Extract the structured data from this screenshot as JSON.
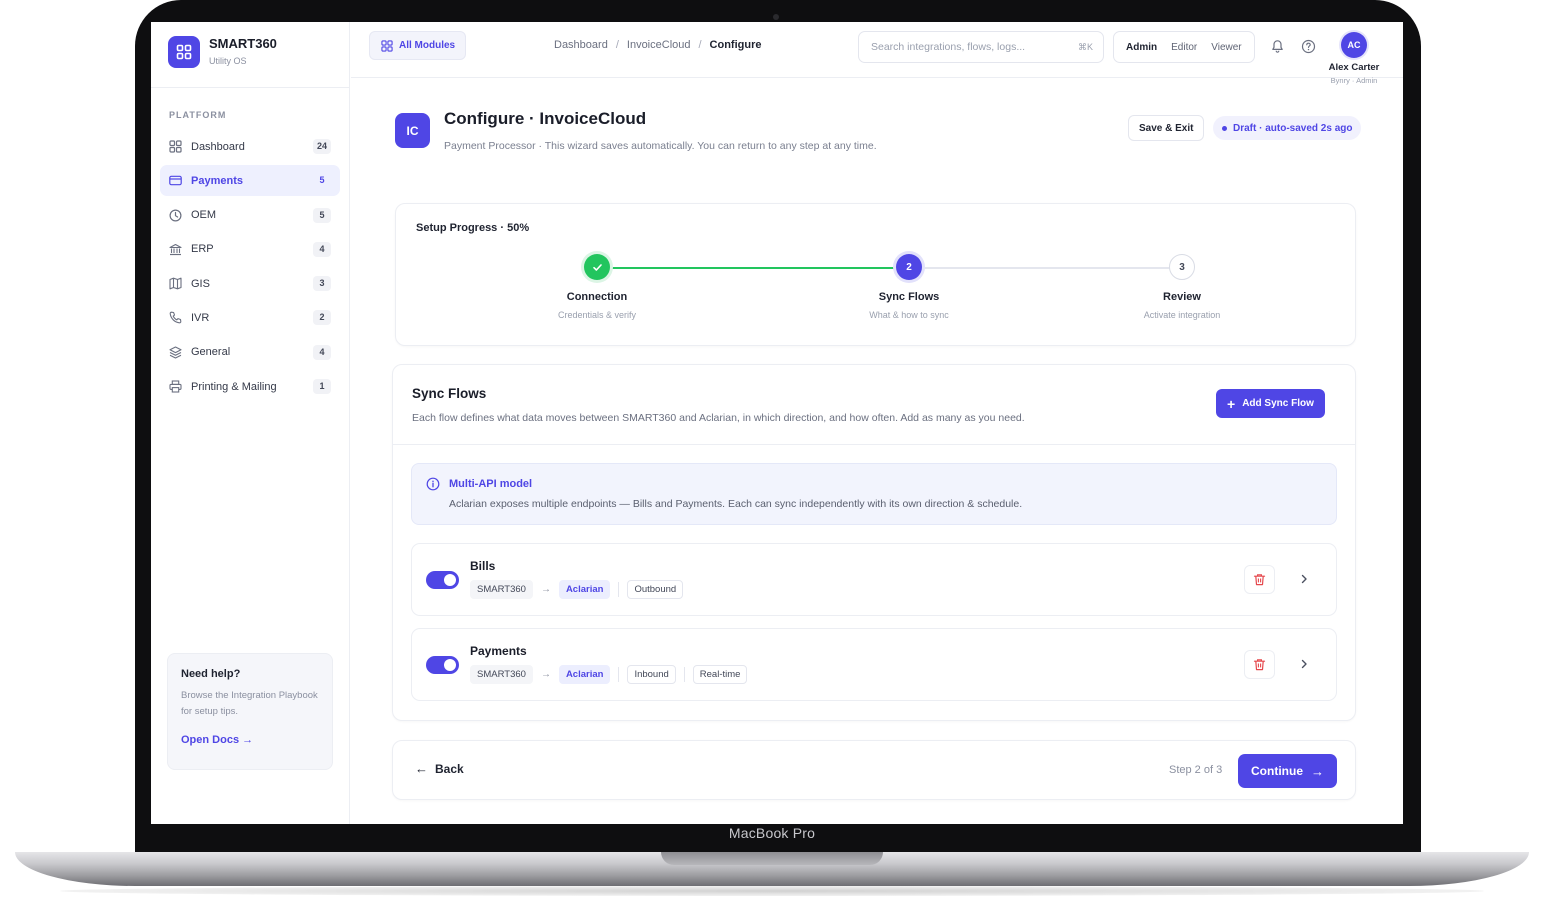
{
  "device": {
    "brand_label": "MacBook Pro"
  },
  "app": {
    "name": "SMART360",
    "subtitle": "Utility OS"
  },
  "sidebar": {
    "section_label": "PLATFORM",
    "items": [
      {
        "label": "Dashboard",
        "count": "24",
        "icon": "grid-icon",
        "active": false
      },
      {
        "label": "Payments",
        "count": "5",
        "icon": "credit-card-icon",
        "active": true
      },
      {
        "label": "OEM",
        "count": "5",
        "icon": "clock-icon",
        "active": false
      },
      {
        "label": "ERP",
        "count": "4",
        "icon": "bank-icon",
        "active": false
      },
      {
        "label": "GIS",
        "count": "3",
        "icon": "map-icon",
        "active": false
      },
      {
        "label": "IVR",
        "count": "2",
        "icon": "phone-icon",
        "active": false
      },
      {
        "label": "General",
        "count": "4",
        "icon": "layers-icon",
        "active": false
      },
      {
        "label": "Printing & Mailing",
        "count": "1",
        "icon": "printer-icon",
        "active": false
      }
    ],
    "help": {
      "title": "Need help?",
      "text": "Browse the Integration Playbook for setup tips.",
      "link": "Open Docs →"
    }
  },
  "topbar": {
    "all_modules": "All Modules",
    "breadcrumb": [
      "Dashboard",
      "InvoiceCloud",
      "Configure"
    ],
    "search_placeholder": "Search integrations, flows, logs...",
    "search_shortcut": "⌘K",
    "roles": [
      "Admin",
      "Editor",
      "Viewer"
    ],
    "active_role": "Admin",
    "user": {
      "initials": "AC",
      "name": "Alex Carter",
      "org": "Bynry · Admin"
    }
  },
  "page": {
    "badge": "IC",
    "title": "Configure · InvoiceCloud",
    "subtitle": "Payment Processor · This wizard saves automatically. You can return to any step at any time.",
    "save_exit": "Save & Exit",
    "draft_status": "Draft · auto-saved 2s ago"
  },
  "progress": {
    "title": "Setup Progress · 50%",
    "percent": 50,
    "steps": [
      {
        "number": "1",
        "name": "Connection",
        "desc": "Credentials & verify",
        "state": "done"
      },
      {
        "number": "2",
        "name": "Sync Flows",
        "desc": "What & how to sync",
        "state": "current"
      },
      {
        "number": "3",
        "name": "Review",
        "desc": "Activate integration",
        "state": "todo"
      }
    ]
  },
  "sync": {
    "title": "Sync Flows",
    "description": "Each flow defines what data moves between SMART360 and Aclarian, in which direction, and how often. Add as many as you need.",
    "add_button": "Add Sync Flow",
    "info": {
      "title": "Multi-API model",
      "text": "Aclarian exposes multiple endpoints — Bills and Payments. Each can sync independently with its own direction & schedule."
    },
    "flows": [
      {
        "name": "Bills",
        "enabled": true,
        "source": "SMART360",
        "arrow": "→",
        "target": "Aclarian",
        "direction": "Outbound",
        "schedule": ""
      },
      {
        "name": "Payments",
        "enabled": true,
        "source": "SMART360",
        "arrow": "→",
        "target": "Aclarian",
        "direction": "Inbound",
        "schedule": "Real-time"
      }
    ]
  },
  "footer": {
    "back": "Back",
    "step_of": "Step 2 of 3",
    "continue": "Continue"
  },
  "colors": {
    "accent": "#4f46e5",
    "success": "#22c55e",
    "danger": "#e5484d"
  }
}
